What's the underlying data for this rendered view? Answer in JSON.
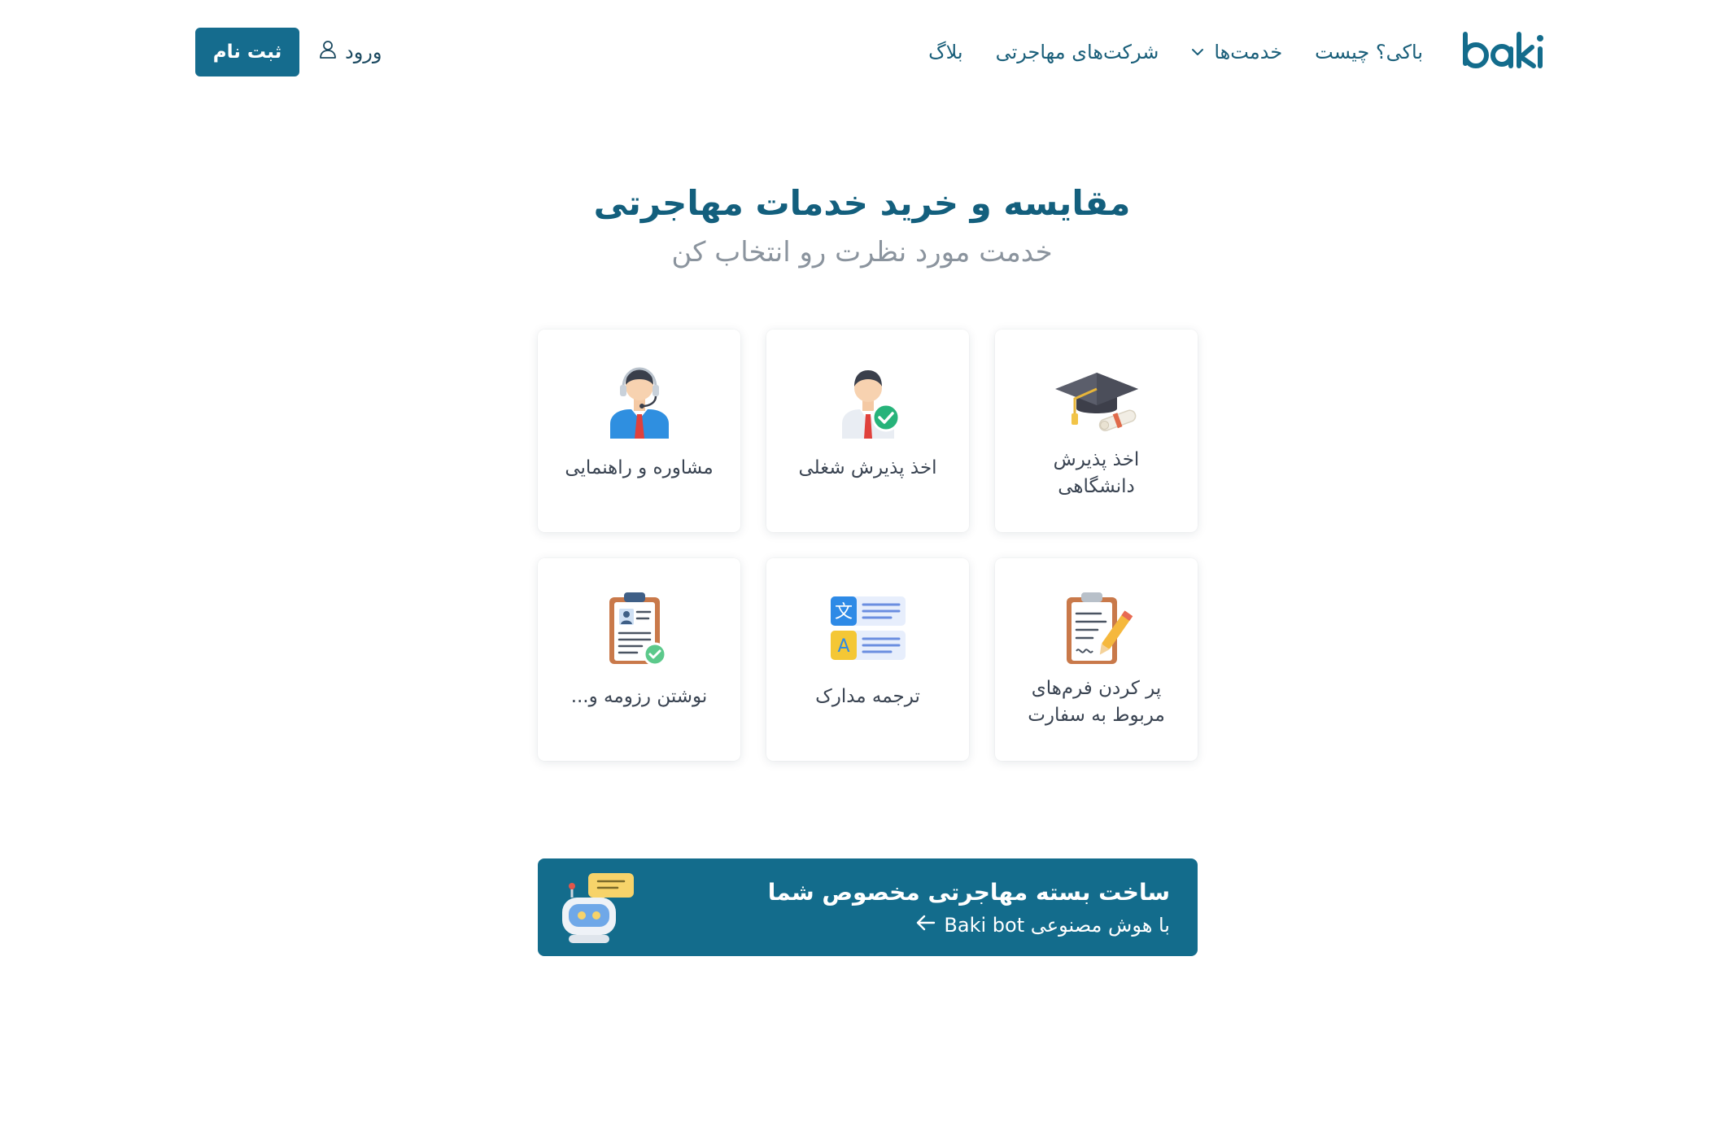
{
  "header": {
    "logo_text": "baki",
    "nav": [
      {
        "label": "باکی؟ چیست"
      },
      {
        "label": "خدمت‌ها",
        "has_dropdown": true
      },
      {
        "label": "شرکت‌های مهاجرتی"
      },
      {
        "label": "بلاگ"
      }
    ],
    "login_label": "ورود",
    "signup_label": "ثبت نام"
  },
  "hero": {
    "title": "مقایسه و خرید خدمات مهاجرتی",
    "subtitle": "خدمت مورد نظرت رو انتخاب کن"
  },
  "services": [
    {
      "label": "اخذ پذیرش دانشگاهی",
      "icon": "graduation-cap-icon"
    },
    {
      "label": "اخذ پذیرش شغلی",
      "icon": "employee-approved-icon"
    },
    {
      "label": "مشاوره و راهنمایی",
      "icon": "support-agent-icon"
    },
    {
      "label": "پر کردن فرم‌های مربوط به سفارت",
      "icon": "clipboard-form-icon"
    },
    {
      "label": "ترجمه مدارک",
      "icon": "translate-icon"
    },
    {
      "label": "نوشتن رزومه و...",
      "icon": "resume-icon"
    }
  ],
  "banner": {
    "title": "ساخت بسته مهاجرتی مخصوص شما",
    "subtitle": "با هوش مصنوعی Baki bot"
  },
  "colors": {
    "primary": "#156c8e",
    "title": "#135f7d",
    "nav": "#1a5f7a",
    "muted": "#8b949e"
  }
}
